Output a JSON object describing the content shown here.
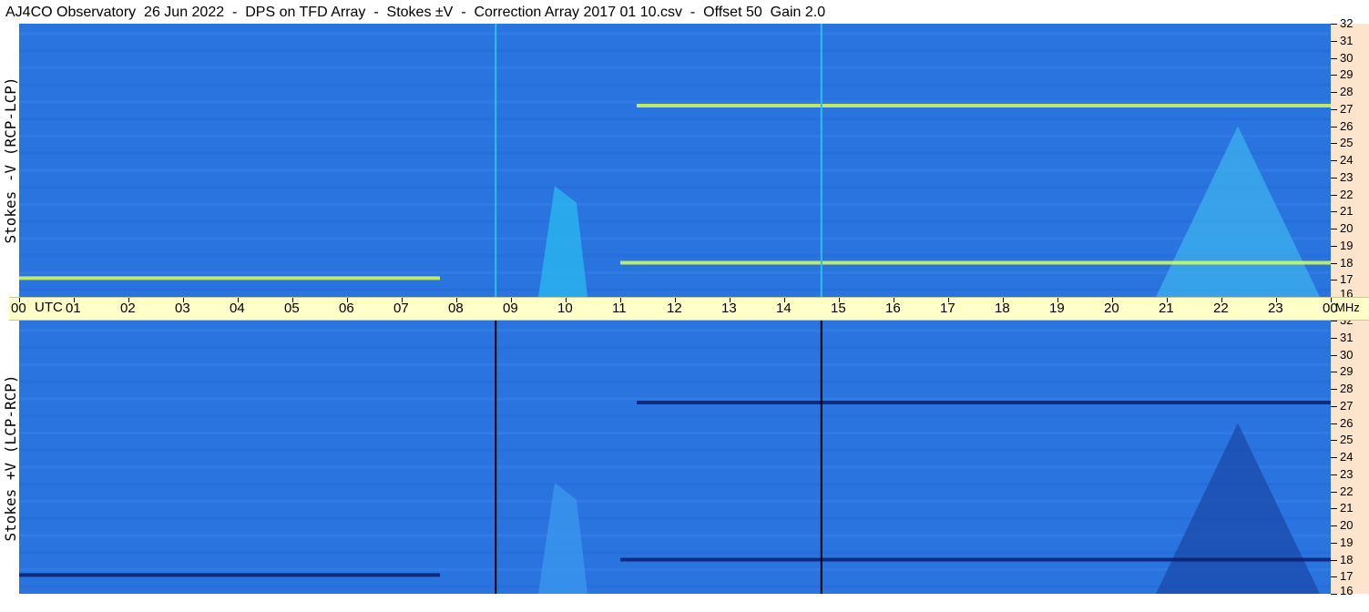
{
  "title": "AJ4CO Observatory  26 Jun 2022  -  DPS on TFD Array  -  Stokes ±V  -  Correction Array 2017 01 10.csv  -  Offset 50  Gain 2.0",
  "panels": {
    "top": {
      "ylabel": "Stokes -V (RCP-LCP)"
    },
    "bottom": {
      "ylabel": "Stokes +V (LCP-RCP)"
    }
  },
  "time_axis": {
    "unit_label": "UTC",
    "freq_unit": "MHz"
  },
  "colors": {
    "background": "#2a74e0",
    "bright": "#2ac0f0",
    "hot": "#d8ff50",
    "dark": "#0a1e70",
    "freq_axis": "#fde4cc",
    "time_axis": "#ffffc8"
  },
  "chart_data": {
    "type": "heatmap",
    "x": {
      "label": "UTC",
      "range": [
        0,
        24
      ],
      "ticks": [
        "00",
        "01",
        "02",
        "03",
        "04",
        "05",
        "06",
        "07",
        "08",
        "09",
        "10",
        "11",
        "12",
        "13",
        "14",
        "15",
        "16",
        "17",
        "18",
        "19",
        "20",
        "21",
        "22",
        "23",
        "00"
      ]
    },
    "y": {
      "label": "MHz",
      "range": [
        16,
        32
      ],
      "ticks": [
        "16",
        "17",
        "18",
        "19",
        "20",
        "21",
        "22",
        "23",
        "24",
        "25",
        "26",
        "27",
        "28",
        "29",
        "30",
        "31",
        "32"
      ]
    },
    "panels": [
      "Stokes -V (RCP-LCP)",
      "Stokes +V (LCP-RCP)"
    ],
    "vertical_markers_utc": [
      8.72,
      14.68
    ],
    "features": [
      {
        "name": "burst",
        "utc_start": 9.5,
        "utc_end": 10.4,
        "mhz_low": 16,
        "mhz_high": 22.5
      },
      {
        "name": "emission-triangle",
        "utc_start": 20.8,
        "utc_peak": 22.3,
        "utc_end": 23.8,
        "mhz_low": 16,
        "mhz_high": 26
      },
      {
        "name": "band",
        "utc_start": 0,
        "utc_end": 7.7,
        "mhz": 17.1
      },
      {
        "name": "band",
        "utc_start": 11,
        "utc_end": 24,
        "mhz": 18
      },
      {
        "name": "band",
        "utc_start": 11.3,
        "utc_end": 24,
        "mhz": 27.2
      }
    ]
  }
}
